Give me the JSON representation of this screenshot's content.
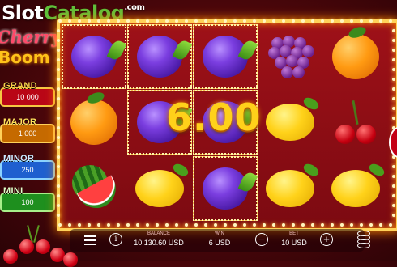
{
  "watermark": {
    "part1": "Slot",
    "part2": "Catalog",
    "part3": ".com"
  },
  "logo": {
    "line1": "Cherry",
    "line2": "Boom"
  },
  "jackpots": {
    "grand": {
      "name": "GRAND",
      "value": "10 000"
    },
    "major": {
      "name": "MAJOR",
      "value": "1 000"
    },
    "minor": {
      "name": "MINOR",
      "value": "250"
    },
    "mini": {
      "name": "MINI",
      "value": "100"
    }
  },
  "reels": [
    [
      "plum",
      "orange",
      "watermelon"
    ],
    [
      "plum",
      "plum",
      "lemon"
    ],
    [
      "plum",
      "plum",
      "plum"
    ],
    [
      "grapes",
      "lemon",
      "lemon"
    ],
    [
      "orange",
      "cherry",
      "lemon"
    ]
  ],
  "win_overlay": {
    "amount": "6.00"
  },
  "bottom_bar": {
    "balance_label": "BALANCE",
    "balance_value": "10 130.60 USD",
    "win_label": "WIN",
    "win_value": "6 USD",
    "bet_label": "BET",
    "bet_value": "10 USD",
    "minus": "−",
    "plus": "+"
  },
  "colors": {
    "frame": "#ffd25a",
    "background": "#7a0f14",
    "win_text": "#ffd11a"
  }
}
